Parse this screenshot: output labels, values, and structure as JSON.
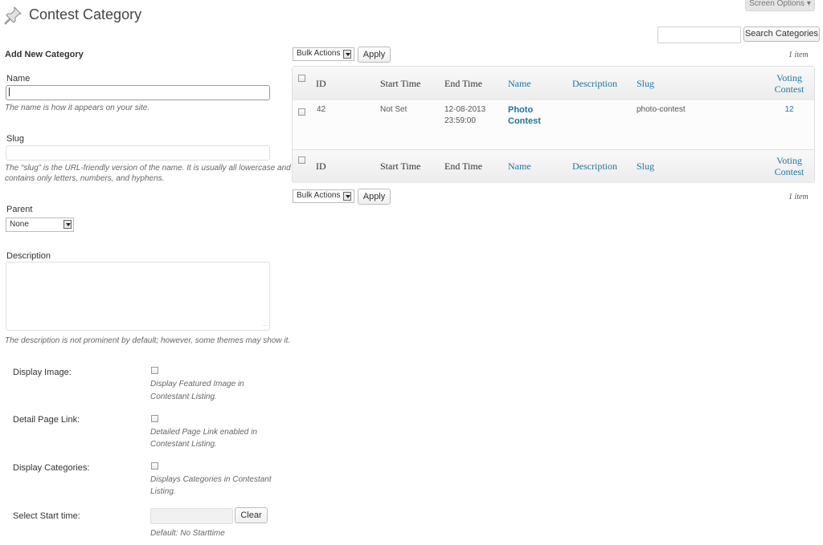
{
  "header": {
    "title": "Contest Category",
    "screen_options": "Screen Options ▾"
  },
  "search": {
    "button_label": "Search Categories",
    "placeholder": ""
  },
  "form": {
    "heading": "Add New Category",
    "name": {
      "label": "Name",
      "value": "",
      "hint": "The name is how it appears on your site."
    },
    "slug": {
      "label": "Slug",
      "value": "",
      "hint_line1": "The “slug” is the URL-friendly version of the name. It is usually all lowercase and",
      "hint_line2": "contains only letters, numbers, and hyphens."
    },
    "parent": {
      "label": "Parent",
      "selected": "None"
    },
    "description": {
      "label": "Description",
      "value": "",
      "hint": "The description is not prominent by default; however, some themes may show it."
    },
    "display_image": {
      "label": "Display Image:",
      "hint_line1": "Display Featured Image in",
      "hint_line2": "Contestant Listing.",
      "checked": false
    },
    "detail_link": {
      "label": "Detail Page Link:",
      "hint_line1": "Detailed Page Link enabled in",
      "hint_line2": "Contestant Listing.",
      "checked": false
    },
    "display_categories": {
      "label": "Display Categories:",
      "hint_line1": "Displays Categories in Contestant",
      "hint_line2": "Listing.",
      "checked": false
    },
    "start_time": {
      "label": "Select Start time:",
      "value": "",
      "clear_label": "Clear",
      "hint": "Default: No Starttime"
    }
  },
  "bulk": {
    "select_label": "Bulk Actions",
    "apply_label": "Apply",
    "items_count": "1 item"
  },
  "table": {
    "columns": {
      "id": "ID",
      "start_time": "Start Time",
      "end_time": "End Time",
      "name": "Name",
      "description": "Description",
      "slug": "Slug",
      "voting_line1": "Voting",
      "voting_line2": "Contest"
    },
    "rows": [
      {
        "id": "42",
        "start_time": "Not Set",
        "end_time_line1": "12-08-2013",
        "end_time_line2": "23:59:00",
        "name_line1": "Photo",
        "name_line2": "Contest",
        "description": "",
        "slug": "photo-contest",
        "voting_contest": "12"
      }
    ]
  },
  "colors": {
    "link": "#21759b",
    "hint_text": "#666666",
    "header_gradient_bottom": "#ececec"
  }
}
